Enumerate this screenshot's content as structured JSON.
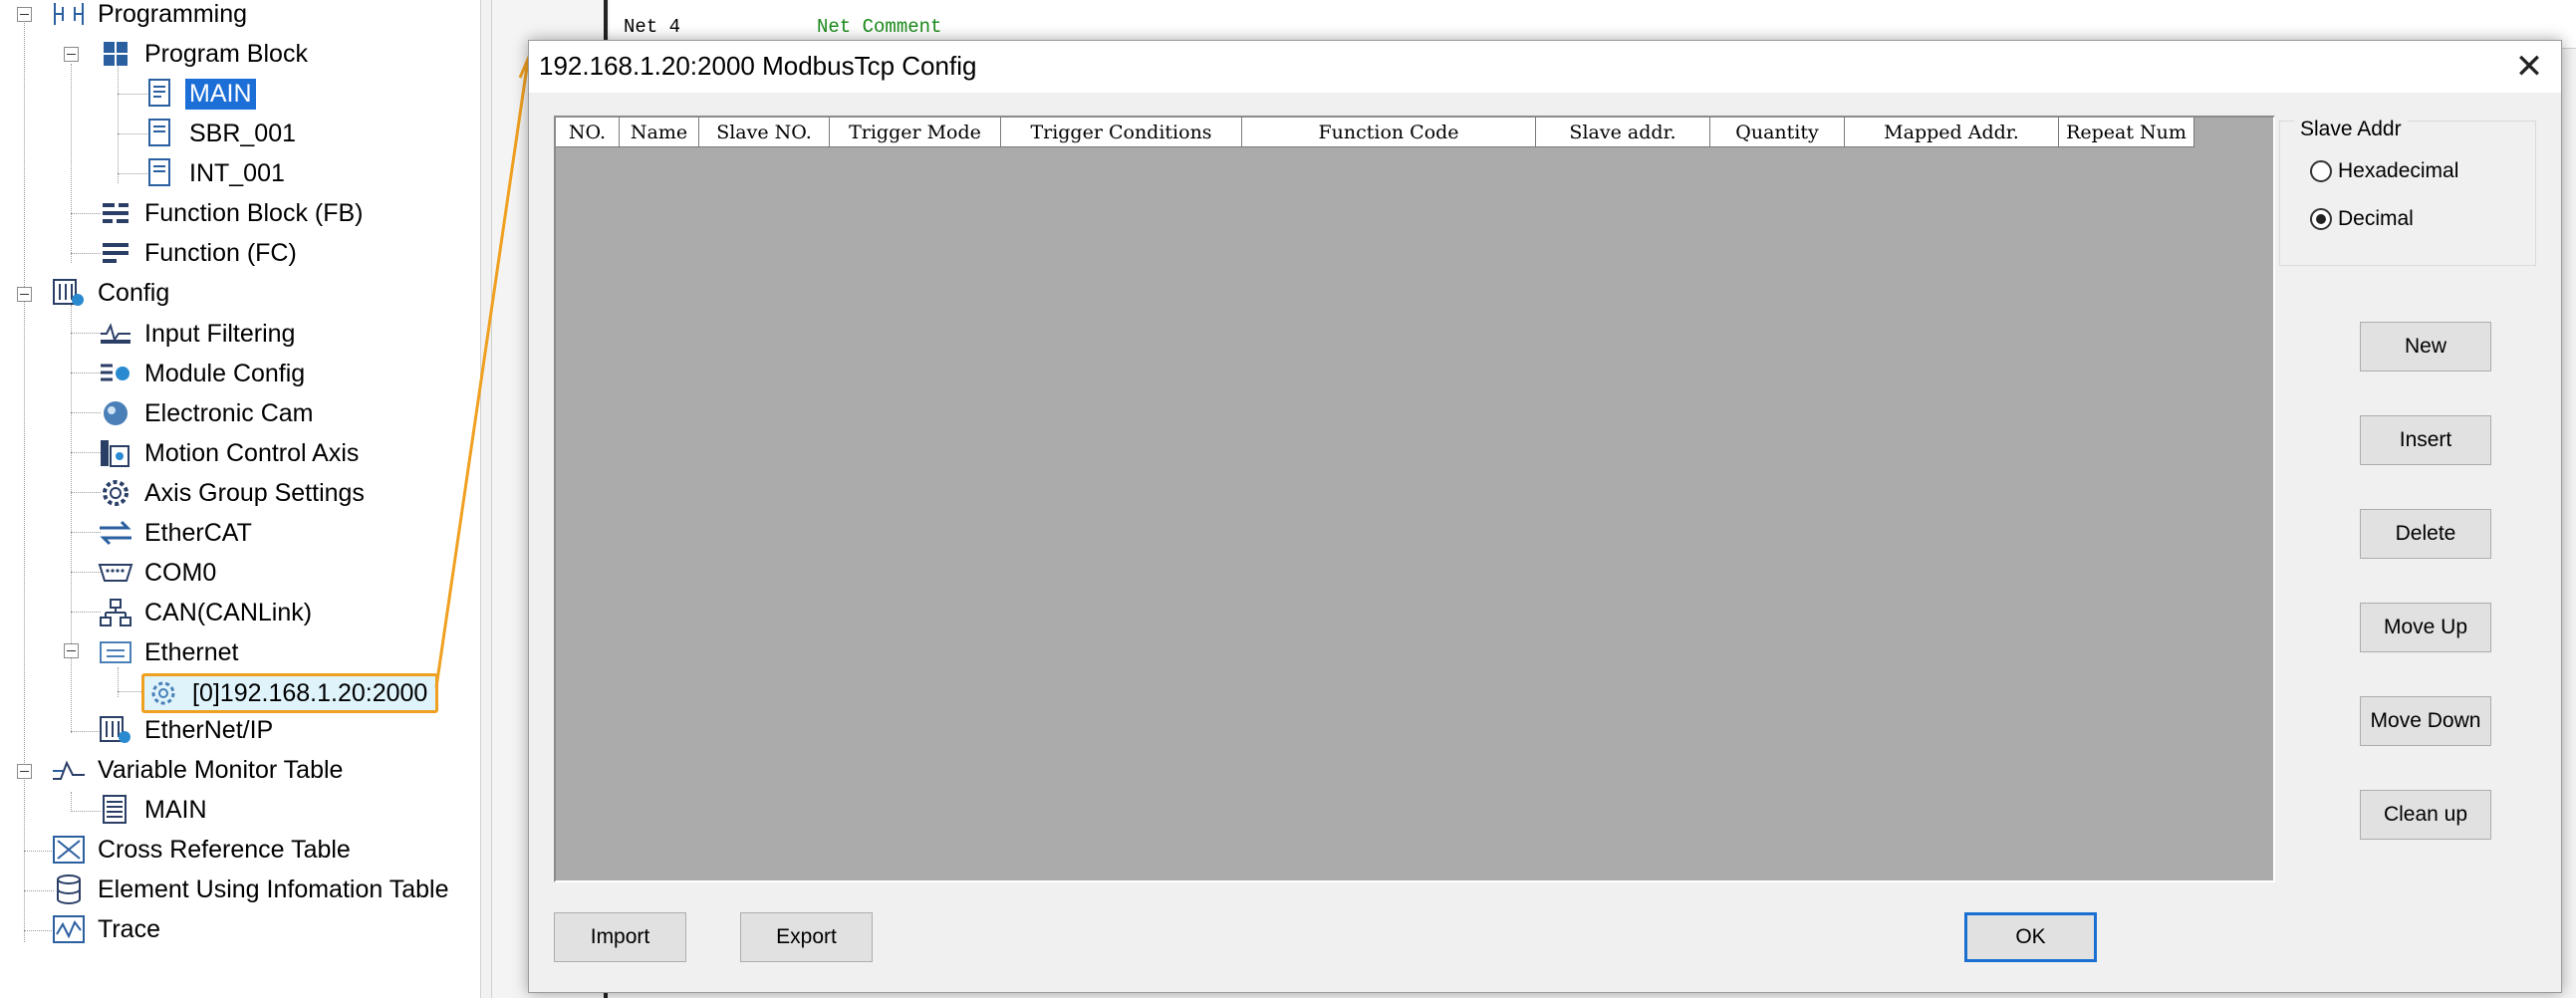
{
  "tree": {
    "programming": "Programming",
    "program_block": "Program Block",
    "main": "MAIN",
    "sbr": "SBR_001",
    "int": "INT_001",
    "function_block": "Function Block (FB)",
    "function_fc": "Function (FC)",
    "config": "Config",
    "input_filtering": "Input Filtering",
    "module_config": "Module Config",
    "electronic_cam": "Electronic Cam",
    "motion_control_axis": "Motion Control Axis",
    "axis_group_settings": "Axis Group Settings",
    "ethercat": "EtherCAT",
    "com0": "COM0",
    "can": "CAN(CANLink)",
    "ethernet": "Ethernet",
    "ethernet_child": "[0]192.168.1.20:2000",
    "ethernet_ip": "EtherNet/IP",
    "variable_monitor_table": "Variable Monitor Table",
    "vmt_main": "MAIN",
    "cross_reference_table": "Cross Reference Table",
    "element_using_info_table": "Element Using Infomation Table",
    "trace": "Trace"
  },
  "editor": {
    "net_label": "Net 4",
    "net_comment": "Net Comment"
  },
  "dialog": {
    "title": "192.168.1.20:2000 ModbusTcp Config",
    "close": "✕",
    "columns": [
      "NO.",
      "Name",
      "Slave NO.",
      "Trigger Mode",
      "Trigger Conditions",
      "Function Code",
      "Slave addr.",
      "Quantity",
      "Mapped Addr.",
      "Repeat Num"
    ],
    "slave_addr": {
      "label": "Slave Addr",
      "hex": "Hexadecimal",
      "dec": "Decimal",
      "selected": "Decimal"
    },
    "buttons": {
      "new": "New",
      "insert": "Insert",
      "delete": "Delete",
      "move_up": "Move Up",
      "move_down": "Move Down",
      "clean_up": "Clean up",
      "import": "Import",
      "export": "Export",
      "ok": "OK"
    }
  },
  "colors": {
    "selection": "#1c6fd6",
    "highlight_border": "#f0a020",
    "grid_background": "#ababab",
    "net_comment": "#1a8a1a",
    "default_button_border": "#1a6fd0"
  }
}
